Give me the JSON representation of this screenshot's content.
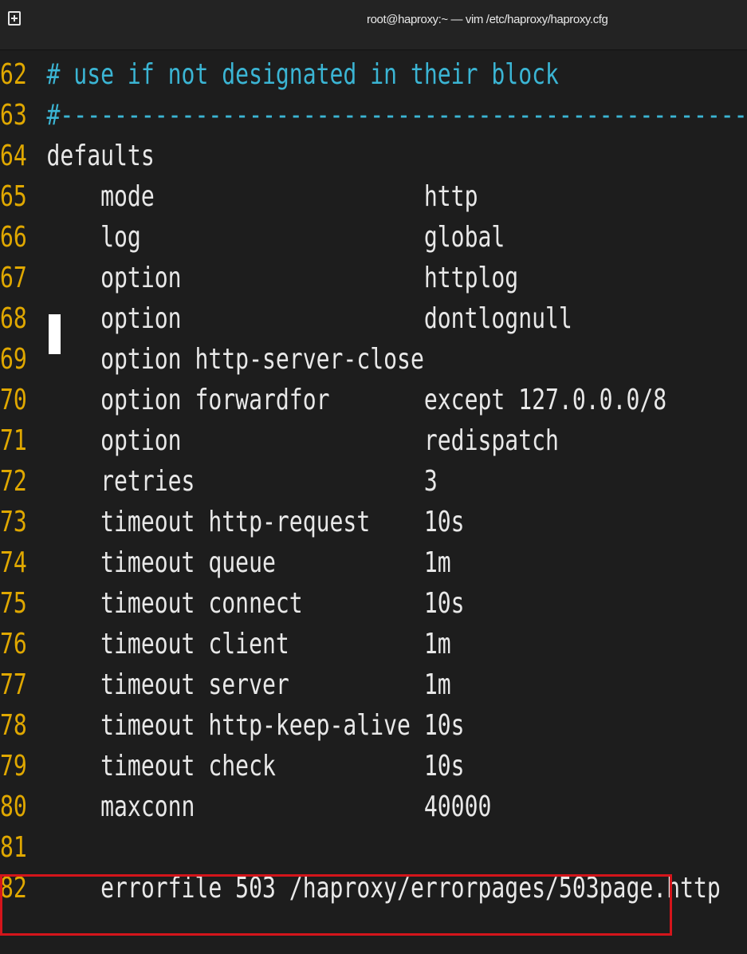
{
  "window": {
    "title": "root@haproxy:~ — vim /etc/haproxy/haproxy.cfg",
    "new_tab_icon": "new-tab-icon"
  },
  "editor": {
    "lines": [
      {
        "num": "62",
        "text": "# use if not designated in their block",
        "kind": "comment"
      },
      {
        "num": "63",
        "text": "#---------------------------------------------------------------------",
        "kind": "comment"
      },
      {
        "num": "64",
        "text": "defaults",
        "kind": "text"
      },
      {
        "num": "65",
        "text": "    mode                    http",
        "kind": "text"
      },
      {
        "num": "66",
        "text": "    log                     global",
        "kind": "text"
      },
      {
        "num": "67",
        "text": "    option                  httplog",
        "kind": "text"
      },
      {
        "num": "68",
        "text": "    option                  dontlognull",
        "kind": "text"
      },
      {
        "num": "69",
        "text": "    option http-server-close",
        "kind": "text"
      },
      {
        "num": "70",
        "text": "    option forwardfor       except 127.0.0.0/8",
        "kind": "text"
      },
      {
        "num": "71",
        "text": "    option                  redispatch",
        "kind": "text"
      },
      {
        "num": "72",
        "text": "    retries                 3",
        "kind": "text"
      },
      {
        "num": "73",
        "text": "    timeout http-request    10s",
        "kind": "text"
      },
      {
        "num": "74",
        "text": "    timeout queue           1m",
        "kind": "text"
      },
      {
        "num": "75",
        "text": "    timeout connect         10s",
        "kind": "text"
      },
      {
        "num": "76",
        "text": "    timeout client          1m",
        "kind": "text"
      },
      {
        "num": "77",
        "text": "    timeout server          1m",
        "kind": "text"
      },
      {
        "num": "78",
        "text": "    timeout http-keep-alive 10s",
        "kind": "text"
      },
      {
        "num": "79",
        "text": "    timeout check           10s",
        "kind": "text"
      },
      {
        "num": "80",
        "text": "    maxconn                 40000",
        "kind": "text"
      },
      {
        "num": "81",
        "text": "",
        "kind": "text"
      },
      {
        "num": "82",
        "text": "    errorfile 503 /haproxy/errorpages/503page.http",
        "kind": "text"
      }
    ],
    "cursor_line": "67"
  },
  "colors": {
    "background": "#1d1d1d",
    "line_number": "#e0a800",
    "comment": "#3bb5d4",
    "text": "#e8e8e8",
    "highlight_box": "#d4151b"
  }
}
